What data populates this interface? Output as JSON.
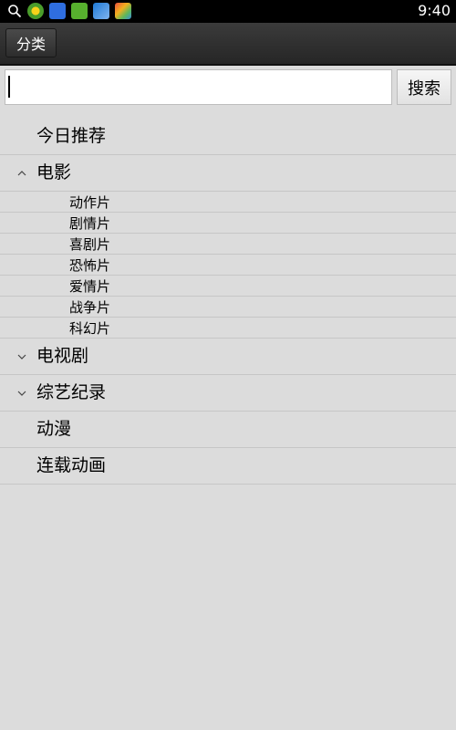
{
  "status_bar": {
    "time": "9:40",
    "icons": [
      "search-icon",
      "app-icon-green-ball",
      "baidu-icon",
      "iqiyi-icon",
      "app-icon-blue-cross",
      "app-icon-colorful"
    ]
  },
  "top_bar": {
    "category_button_label": "分类"
  },
  "search": {
    "value": "",
    "placeholder": "",
    "button_label": "搜索"
  },
  "categories": [
    {
      "label": "今日推荐",
      "expandable": false
    },
    {
      "label": "电影",
      "expandable": true,
      "expanded": true,
      "children": [
        "动作片",
        "剧情片",
        "喜剧片",
        "恐怖片",
        "爱情片",
        "战争片",
        "科幻片"
      ]
    },
    {
      "label": "电视剧",
      "expandable": true,
      "expanded": false
    },
    {
      "label": "综艺纪录",
      "expandable": true,
      "expanded": false
    },
    {
      "label": "动漫",
      "expandable": false
    },
    {
      "label": "连载动画",
      "expandable": false
    }
  ],
  "colors": {
    "background": "#dcdcdc",
    "status_bar": "#000000",
    "top_bar": "#2d2d2d",
    "divider": "#c6c6c6"
  }
}
